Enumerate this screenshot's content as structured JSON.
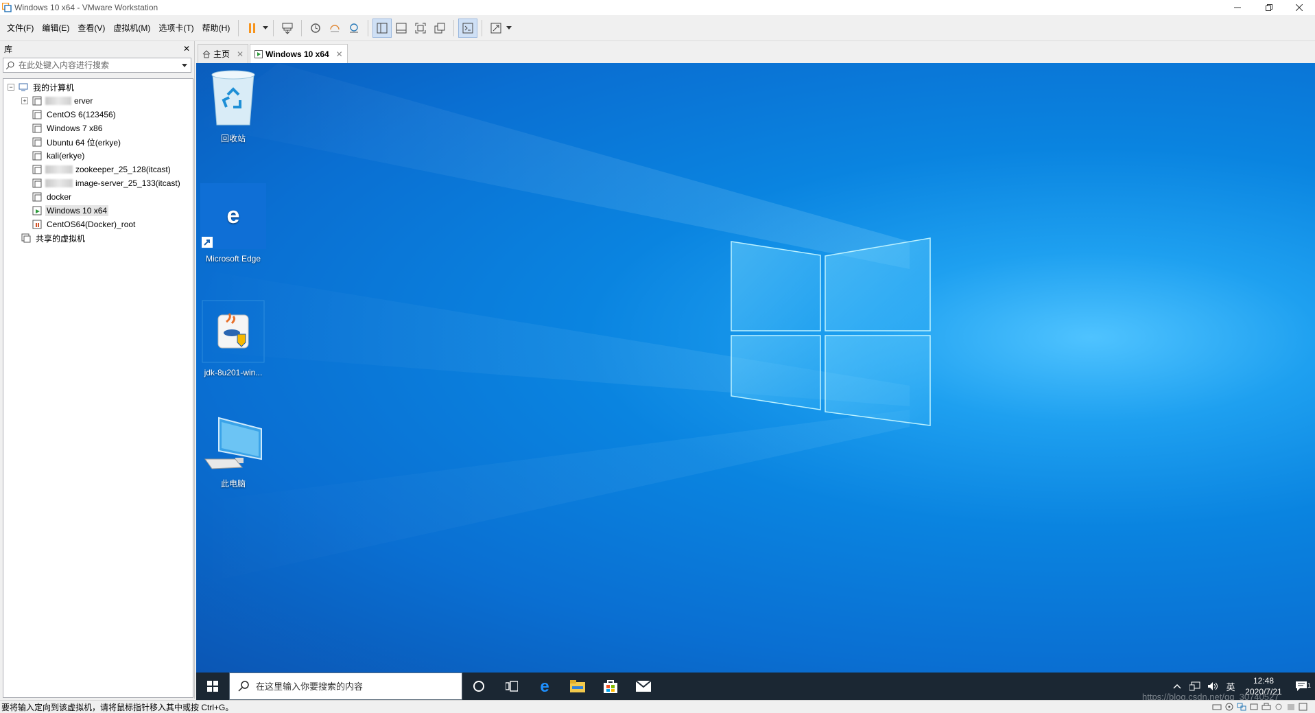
{
  "window": {
    "title": "Windows 10 x64 - VMware Workstation",
    "icon": "vmware-icon",
    "controls": [
      "minimize-icon",
      "restore-icon",
      "close-icon"
    ]
  },
  "menu": [
    {
      "label": "文件(F)"
    },
    {
      "label": "编辑(E)"
    },
    {
      "label": "查看(V)"
    },
    {
      "label": "虚拟机(M)"
    },
    {
      "label": "选项卡(T)"
    },
    {
      "label": "帮助(H)"
    }
  ],
  "toolbar": {
    "pause_color": "#f7941d",
    "buttons": [
      "pause-icon",
      "send-ctrl-alt-del-icon",
      "snapshot-icon",
      "revert-snapshot-icon",
      "snapshot-manager-icon",
      "library-view-icon",
      "thumbnail-bar-icon",
      "fullscreen-icon",
      "unity-icon",
      "console-icon",
      "stretch-icon"
    ]
  },
  "library": {
    "title": "库",
    "close": "✕",
    "search_placeholder": "在此处键入内容进行搜索",
    "tree": {
      "root": "我的计算机",
      "items": [
        {
          "label": "erver",
          "obscured": true,
          "expandable": true
        },
        {
          "label": "CentOS 6(123456)"
        },
        {
          "label": "Windows 7 x86"
        },
        {
          "label": "Ubuntu 64 位(erkye)"
        },
        {
          "label": "kali(erkye)"
        },
        {
          "label": "zookeeper_25_128(itcast)",
          "obscured": true
        },
        {
          "label": "image-server_25_133(itcast)",
          "obscured": true
        },
        {
          "label": "docker"
        },
        {
          "label": "Windows 10 x64",
          "selected": true,
          "running": true
        },
        {
          "label": "CentOS64(Docker)_root",
          "shared_state": true
        }
      ],
      "shared": "共享的虚拟机"
    }
  },
  "tabs": [
    {
      "label": "主页",
      "icon": "home-icon",
      "close": "✕"
    },
    {
      "label": "Windows 10 x64",
      "icon": "vm-running-icon",
      "close": "✕",
      "active": true
    }
  ],
  "desktop": {
    "icons": [
      {
        "label": "回收站",
        "icon": "recycle-bin-icon"
      },
      {
        "label": "Microsoft Edge",
        "icon": "edge-icon"
      },
      {
        "label": "jdk-8u201-win...",
        "icon": "java-installer-icon"
      },
      {
        "label": "此电脑",
        "icon": "this-pc-icon"
      }
    ]
  },
  "taskbar": {
    "search_placeholder": "在这里输入你要搜索的内容",
    "tray": {
      "ime": "英",
      "time": "12:48",
      "date": "2020/7/21",
      "notifications": "1"
    },
    "watermark": "https://blog.csdn.net/qq_30740527"
  },
  "status": {
    "message": "要将输入定向到该虚拟机，请将鼠标指针移入其中或按 Ctrl+G。"
  }
}
